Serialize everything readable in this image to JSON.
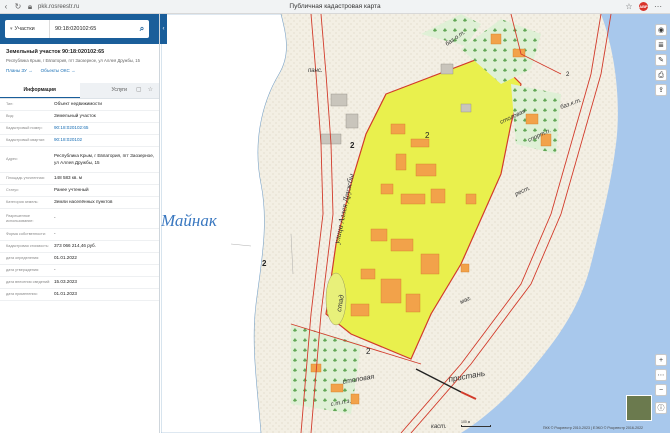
{
  "browser": {
    "url": "pkk.rosreestr.ru",
    "title": "Публичная кадастровая карта"
  },
  "search": {
    "type": "Участки",
    "value": "90:18:020102:65"
  },
  "object": {
    "title": "Земельный участок 90:18:020102:65",
    "address": "Республика Крым, г Евпатория, пгт Заозерное, ул Аллея Дружбы, 15",
    "link_plans": "Планы ЗУ →",
    "link_oks": "Объекты ОКС →"
  },
  "tabs": [
    {
      "label": "Информация"
    },
    {
      "label": "Услуги"
    }
  ],
  "info": [
    {
      "key": "Тип:",
      "value": "Объект недвижимости"
    },
    {
      "key": "Вид:",
      "value": "Земельный участок"
    },
    {
      "key": "Кадастровый номер:",
      "value": "90:18:020102:65"
    },
    {
      "key": "Кадастровый квартал:",
      "value": "90:18:020102"
    },
    {
      "key": "Адрес:",
      "value": "Республика Крым, г Евпатория, пгт Заозерное, ул Аллея Дружбы, 15"
    },
    {
      "key": "Площадь уточненная:",
      "value": "148 583 кв. м"
    },
    {
      "key": "Статус:",
      "value": "Ранее учтенный"
    },
    {
      "key": "Категория земель:",
      "value": "Земли населённых пунктов"
    },
    {
      "key": "Разрешенное использование:",
      "value": "-"
    },
    {
      "key": "Форма собственности:",
      "value": "-"
    },
    {
      "key": "Кадастровая стоимость:",
      "value": "373 066 214,46 руб."
    },
    {
      "key": "дата определения:",
      "value": "01.01.2022"
    },
    {
      "key": "дата утверждения:",
      "value": "-"
    },
    {
      "key": "дата внесения сведений:",
      "value": "15.03.2023"
    },
    {
      "key": "дата применения:",
      "value": "01.01.2023"
    }
  ],
  "map": {
    "labels": {
      "lake": "Майнак",
      "street": "улица Аллея Дружбы",
      "pans": "панс.",
      "bazaP": "баз.о.т.",
      "bazaK": "баз.к.т.",
      "stolovaya1": "столовая",
      "sport": "спорт.п.",
      "rest": "рест.",
      "stad": "стад",
      "mag": "маг.",
      "stolovaya2": "столовая",
      "sanat": "с.т.п.з.",
      "pristan": "пристань",
      "kast": "каст.",
      "num2a": "2",
      "num2b": "2",
      "num2c": "2",
      "num2d": "2",
      "num2e": "2"
    },
    "scale_label": "100 м",
    "copyright": "ПКК © Росреестр 2010-2023 | ЕЭКО © Росреестр 2016-2022"
  }
}
